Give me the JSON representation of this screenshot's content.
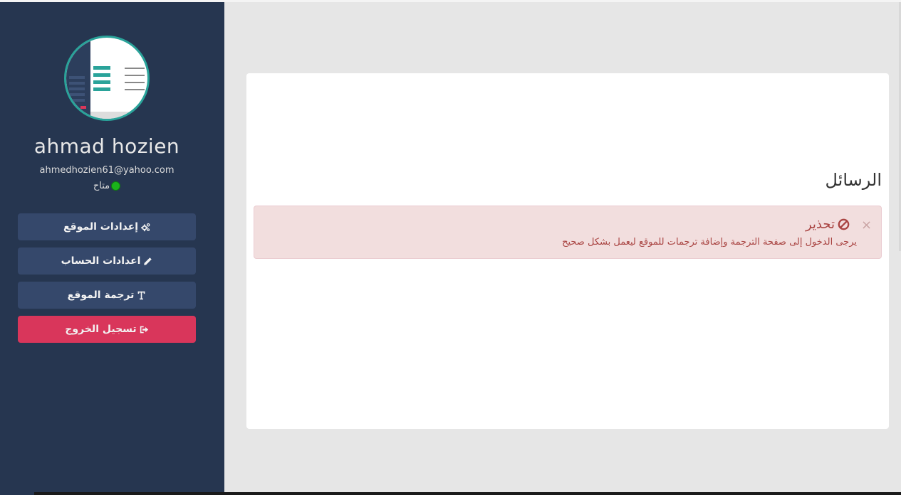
{
  "sidebar": {
    "user": {
      "name": "ahmad hozien",
      "email": "ahmedhozien61@yahoo.com",
      "status": "متاح",
      "status_color": "#1bb21b"
    },
    "buttons": [
      {
        "label": "إعدادات الموقع",
        "icon": "gears-icon"
      },
      {
        "label": "اعدادات الحساب",
        "icon": "pencil-icon"
      },
      {
        "label": "ترجمة الموقع",
        "icon": "text-icon"
      },
      {
        "label": "تسجيل الخروج",
        "icon": "sign-out-icon"
      }
    ]
  },
  "main": {
    "title": "الرسائل",
    "alert": {
      "title": "تحذير",
      "message": "يرجى الدخول إلى صفحة الترجمة وإضافة ترجمات للموقع ليعمل بشكل صحيح",
      "close": "×"
    }
  },
  "colors": {
    "sidebar_bg": "#263650",
    "button_bg": "#35486b",
    "logout_bg": "#d9365b",
    "accent": "#2aa39a",
    "alert_text": "#a94442",
    "alert_bg": "#f2dede"
  }
}
